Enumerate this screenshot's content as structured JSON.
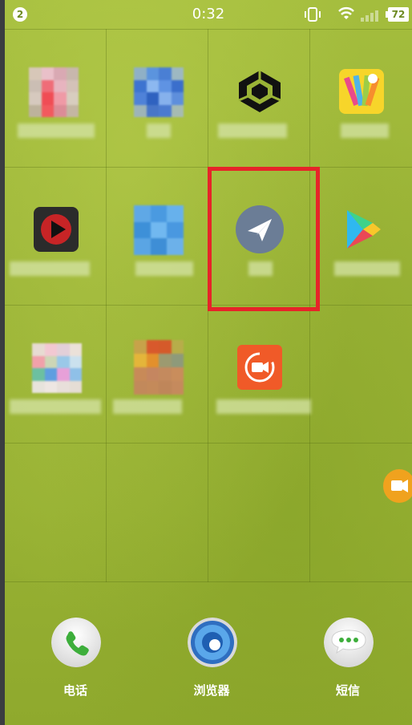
{
  "status_bar": {
    "notification_count": "2",
    "time": "0:32",
    "battery": "72"
  },
  "grid": {
    "rows": 4,
    "columns": 4
  },
  "apps": [
    {
      "name": "pixelated-app-1",
      "icon": "blurred-icon",
      "label": ""
    },
    {
      "name": "pixelated-app-2",
      "icon": "blurred-icon",
      "label": ""
    },
    {
      "name": "unity-app",
      "icon": "unity-icon",
      "label": ""
    },
    {
      "name": "drawing-app",
      "icon": "colored-pencils-icon",
      "label": ""
    },
    {
      "name": "video-player-app",
      "icon": "play-icon",
      "label": ""
    },
    {
      "name": "pixelated-app-3",
      "icon": "blurred-icon",
      "label": ""
    },
    {
      "name": "paper-plane-app",
      "icon": "paper-plane-icon",
      "label": "",
      "selected": true
    },
    {
      "name": "play-store-app",
      "icon": "play-store-icon",
      "label": ""
    },
    {
      "name": "pixelated-app-4",
      "icon": "blurred-icon",
      "label": ""
    },
    {
      "name": "pixelated-app-5",
      "icon": "blurred-icon",
      "label": ""
    },
    {
      "name": "screen-recorder-app",
      "icon": "video-camera-icon",
      "label": ""
    }
  ],
  "dock": [
    {
      "label": "电话",
      "icon": "phone-icon"
    },
    {
      "label": "浏览器",
      "icon": "browser-icon"
    },
    {
      "label": "短信",
      "icon": "message-icon"
    }
  ],
  "floating_button": {
    "icon": "video-camera-icon"
  },
  "colors": {
    "selection_border": "#e62429",
    "wallpaper": "#9ab336"
  }
}
